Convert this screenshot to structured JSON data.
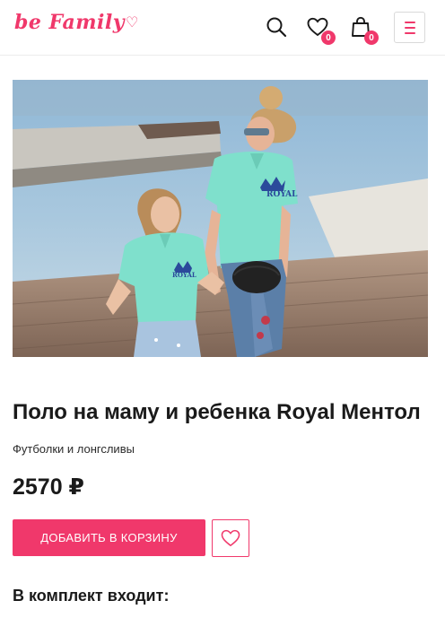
{
  "header": {
    "logo_text": "be Family",
    "wishlist_count": "0",
    "cart_count": "0"
  },
  "icons": {
    "search": "search-icon",
    "wishlist": "heart-icon",
    "cart": "bag-icon",
    "menu": "menu-icon",
    "favorite": "heart-icon"
  },
  "product": {
    "title": "Поло на маму и ребенка Royal Ментол",
    "category": "Футболки и лонгсливы",
    "price": "2570 ₽",
    "add_to_cart_label": "ДОБАВИТЬ В КОРЗИНУ",
    "kit_heading": "В комплект входит:"
  },
  "colors": {
    "accent": "#f0386b",
    "text": "#1a1a1a",
    "mint_polo": "#7fe0cc",
    "jeans": "#5b7fa8"
  }
}
